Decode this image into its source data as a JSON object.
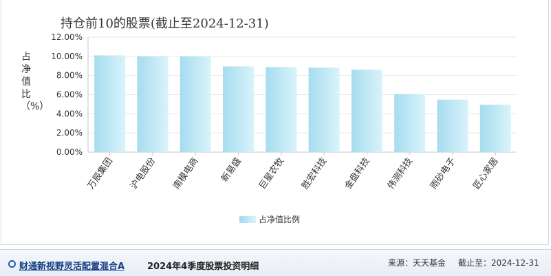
{
  "chart_data": {
    "type": "bar",
    "title": "持仓前10的股票(截止至2024-12-31)",
    "ylabel": "占净值比（%）",
    "xlabel": "",
    "categories": [
      "万辰集团",
      "沪电股份",
      "南模电商",
      "新易盛",
      "巨星农牧",
      "胜宏科技",
      "金盘科技",
      "伟测科技",
      "雨砂电子",
      "匠心家居"
    ],
    "series": [
      {
        "name": "占净值比例",
        "values": [
          10.1,
          10.0,
          9.98,
          8.95,
          8.88,
          8.82,
          8.6,
          6.05,
          5.48,
          4.95
        ]
      }
    ],
    "ylim": [
      0,
      12
    ],
    "yticks": [
      "0.00%",
      "2.00%",
      "4.00%",
      "6.00%",
      "8.00%",
      "10.00%",
      "12.00%"
    ],
    "grid": true,
    "legend": "bottom-center",
    "bar_color_start": "#a6dcef",
    "bar_color_end": "#d9f3fb"
  },
  "footer": {
    "fund_name": "财通新视野灵活配置混合A",
    "report_title": "2024年4季度股票投资明细",
    "source_label": "来源：天天基金",
    "date_label": "截止至：2024-12-31"
  }
}
